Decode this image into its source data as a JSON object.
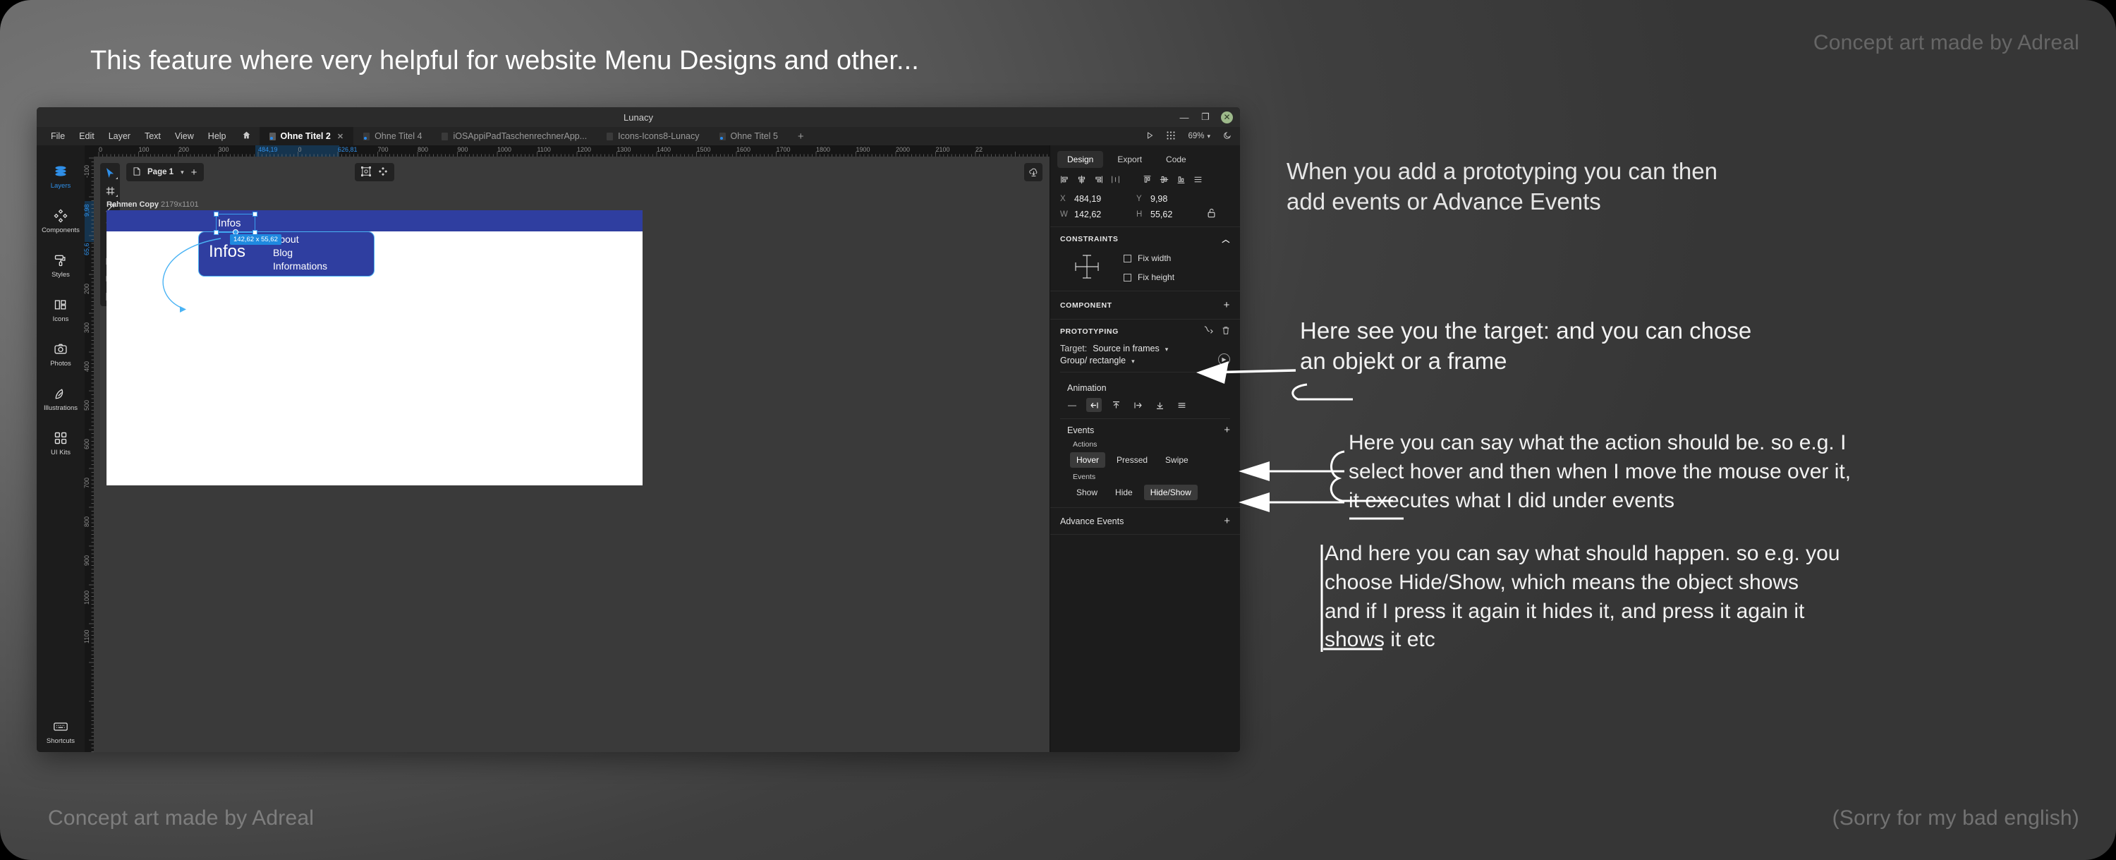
{
  "headline": "This feature where very helpful for website Menu Designs and other...",
  "watermarks": {
    "top_right": "Concept art made by Adreal",
    "bottom_left": "Concept art made by Adreal",
    "bottom_right": "(Sorry for my bad english)"
  },
  "callouts": {
    "c1": "When you add a prototyping you can then\nadd events or Advance Events",
    "c2": "Here see you the target: and you can chose\nan objekt or a frame",
    "c3": "Here you can say what the action should be. so e.g. I\nselect hover and then when I move the mouse over it,\nit executes what I did under events",
    "c4": "And here you can say what should happen. so e.g. you\nchoose Hide/Show, which means the object shows\nand if I press it again it hides it, and press it again it\nshows it etc"
  },
  "app": {
    "title": "Lunacy",
    "menu": [
      "File",
      "Edit",
      "Layer",
      "Text",
      "View",
      "Help"
    ],
    "tabs": [
      {
        "label": "Ohne Titel 2",
        "active": true,
        "closable": true
      },
      {
        "label": "Ohne Titel 4",
        "active": false,
        "closable": false
      },
      {
        "label": "iOSAppiPadTaschenrechnerApp...",
        "active": false,
        "closable": false
      },
      {
        "label": "Icons-Icons8-Lunacy",
        "active": false,
        "closable": false
      },
      {
        "label": "Ohne Titel 5",
        "active": false,
        "closable": false
      }
    ],
    "tab_add": "+",
    "window_controls": {
      "minimize": "—",
      "maximize": "❐",
      "close": "✕"
    },
    "zoom_level": "69%",
    "left_rail": [
      {
        "label": "Layers",
        "icon": "layers-icon",
        "active": true
      },
      {
        "label": "Components",
        "icon": "components-icon",
        "active": false
      },
      {
        "label": "Styles",
        "icon": "styles-icon",
        "active": false
      },
      {
        "label": "Icons",
        "icon": "icons-icon",
        "active": false
      },
      {
        "label": "Photos",
        "icon": "photos-icon",
        "active": false
      },
      {
        "label": "Illustrations",
        "icon": "illustrations-icon",
        "active": false
      },
      {
        "label": "UI Kits",
        "icon": "ui-kits-icon",
        "active": false
      }
    ],
    "left_rail_bottom": {
      "label": "Shortcuts",
      "icon": "keyboard-icon"
    },
    "page_selector": {
      "label": "Page 1",
      "add": "+"
    },
    "ruler_h": [
      "0",
      "100",
      "200",
      "300",
      "484,19",
      "0",
      "626,81",
      "700",
      "800",
      "900",
      "1000",
      "1100",
      "1200",
      "1300",
      "1400",
      "1500",
      "1600",
      "1700",
      "1800",
      "1900",
      "2000",
      "2100",
      "22"
    ],
    "ruler_h_highlight": [
      "484,19",
      "626,81"
    ],
    "ruler_v": [
      "-100",
      "9,98",
      "65,6",
      "200",
      "300",
      "400",
      "500",
      "600",
      "700",
      "800",
      "900",
      "1000",
      "1100"
    ],
    "ruler_v_highlight": [
      "9,98",
      "65,6"
    ],
    "artboard": {
      "name": "Rahmen Copy",
      "size": "2179x1101"
    },
    "design": {
      "navbar_item": "Infos",
      "dropdown_title": "Infos",
      "dropdown_links": [
        "About",
        "Blog",
        "Informations"
      ],
      "selection_size_badge": "142,62 x 55,62",
      "accent_blue": "#2f3ea0",
      "selection_blue": "#3aa0ef"
    },
    "inspector": {
      "tabs": [
        {
          "label": "Design",
          "active": true
        },
        {
          "label": "Export",
          "active": false
        },
        {
          "label": "Code",
          "active": false
        }
      ],
      "geometry": [
        {
          "key": "X",
          "value": "484,19"
        },
        {
          "key": "Y",
          "value": "9,98"
        },
        {
          "key": "W",
          "value": "142,62"
        },
        {
          "key": "H",
          "value": "55,62"
        }
      ],
      "lock_icon": "unlocked-padlock-icon",
      "constraints": {
        "title": "CONSTRAINTS",
        "collapse": "^",
        "fix_width": "Fix width",
        "fix_height": "Fix height"
      },
      "component": {
        "title": "COMPONENT",
        "add": "+"
      },
      "prototyping": {
        "title": "PROTOTYPING",
        "link_icon": "prototype-link-icon",
        "delete_icon": "trash-icon",
        "target_label": "Target:",
        "target_value": "Source in frames",
        "target_value2": "Group/ rectangle",
        "play_icon": "play-icon",
        "animation_label": "Animation",
        "animation_options": [
          "none",
          "slide-left",
          "slide-up",
          "slide-right",
          "slide-down",
          "menu"
        ],
        "animation_selected_index": 1,
        "events_label": "Events",
        "events_add": "+",
        "actions_label": "Actions",
        "actions": [
          "Hover",
          "Pressed",
          "Swipe"
        ],
        "actions_selected": "Hover",
        "events_sub_label": "Events",
        "events": [
          "Show",
          "Hide",
          "Hide/Show"
        ],
        "events_selected": "Hide/Show",
        "advance_events_label": "Advance Events",
        "advance_events_add": "+"
      }
    }
  }
}
